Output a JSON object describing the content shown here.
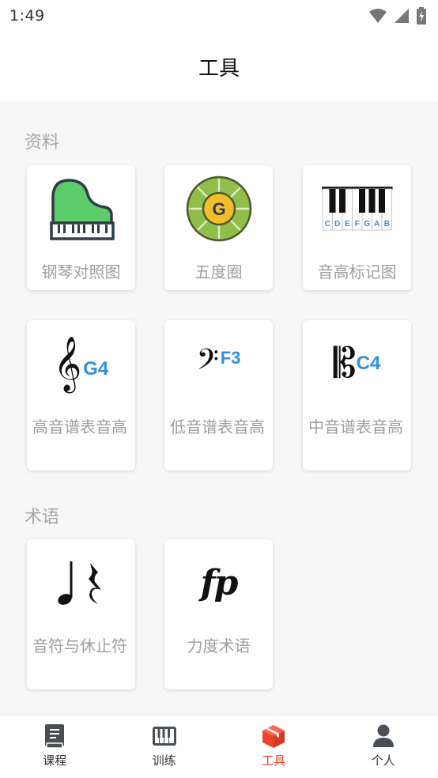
{
  "status_bar": {
    "time": "1:49"
  },
  "header": {
    "title": "工具"
  },
  "sections": {
    "materials": {
      "title": "资料",
      "cards": [
        {
          "label": "钢琴对照图",
          "icon": "grand-piano-icon"
        },
        {
          "label": "五度圈",
          "icon": "circle-of-fifths-icon",
          "icon_text": "G"
        },
        {
          "label": "音高标记图",
          "icon": "keyboard-note-names-icon",
          "keys": [
            "C",
            "D",
            "E",
            "F",
            "G",
            "A",
            "B"
          ]
        },
        {
          "label": "高音谱表音高",
          "icon": "treble-clef-icon",
          "note": "G4"
        },
        {
          "label": "低音谱表音高",
          "icon": "bass-clef-icon",
          "note": "F3"
        },
        {
          "label": "中音谱表音高",
          "icon": "alto-clef-icon",
          "note": "C4"
        }
      ]
    },
    "terms": {
      "title": "术语",
      "cards": [
        {
          "label": "音符与休止符",
          "icon": "note-and-rest-icon"
        },
        {
          "label": "力度术语",
          "icon": "dynamics-fp-icon",
          "icon_text": "fp"
        }
      ]
    }
  },
  "tabbar": {
    "tabs": [
      {
        "label": "课程",
        "icon": "book-icon"
      },
      {
        "label": "训练",
        "icon": "piano-keys-icon"
      },
      {
        "label": "工具",
        "icon": "toolbox-icon",
        "active": true
      },
      {
        "label": "个人",
        "icon": "person-icon"
      }
    ]
  },
  "colors": {
    "accent": "#e8452c",
    "note_blue": "#2f8fe0",
    "piano_green": "#5ccb6a",
    "circle_yellow": "#f4bd2a"
  }
}
